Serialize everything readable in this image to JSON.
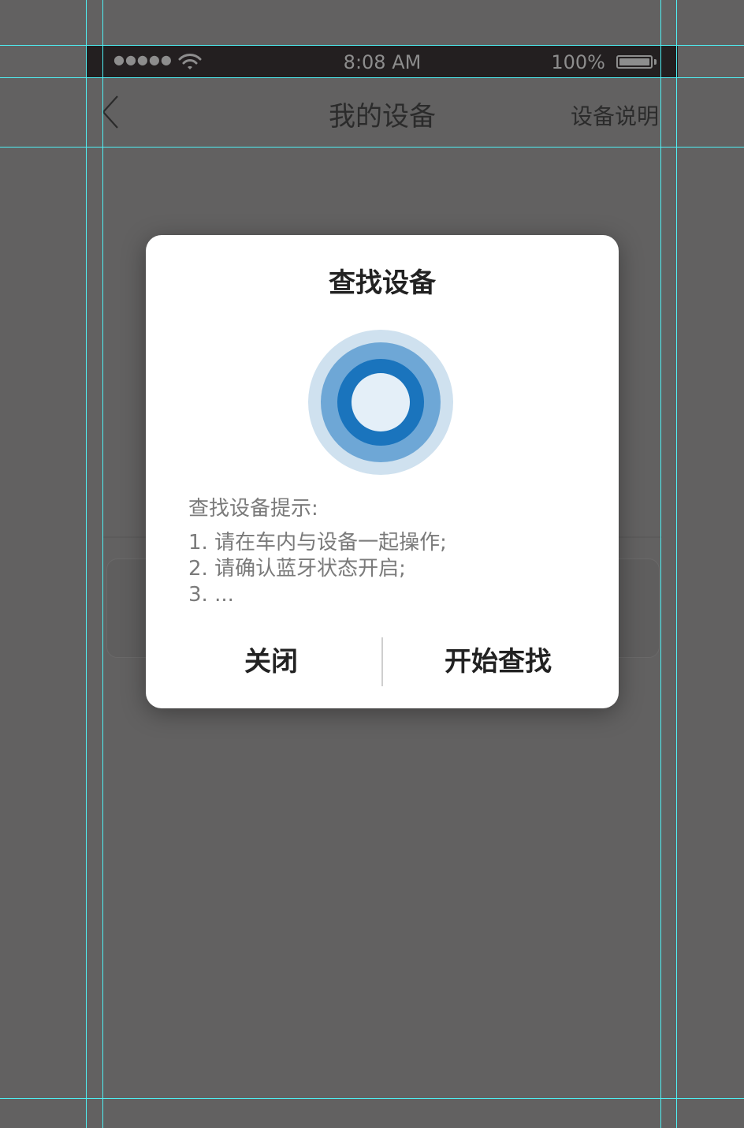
{
  "status_bar": {
    "signal": "●●●●●",
    "wifi_icon": "wifi-icon",
    "time": "8:08 AM",
    "battery_percent": "100%",
    "battery_level": 1.0
  },
  "nav": {
    "back_icon": "chevron-left-icon",
    "title": "我的设备",
    "right_label": "设备说明"
  },
  "dialog": {
    "title": "查找设备",
    "graphic_icon": "search-radar-icon",
    "tips_title": "查找设备提示:",
    "tips": [
      "1. 请在车内与设备一起操作;",
      "2. 请确认蓝牙状态开启;",
      "3. ..."
    ],
    "close_label": "关闭",
    "start_label": "开始查找"
  },
  "colors": {
    "overlay_background": "#626161",
    "status_bar": "#231f20",
    "ring_outer": "#cfe1ef",
    "ring_middle": "#6ea7d6",
    "ring_inner": "#1a74bd",
    "ring_center": "#e4eff8",
    "guide_lines": "#4ff0f4"
  }
}
